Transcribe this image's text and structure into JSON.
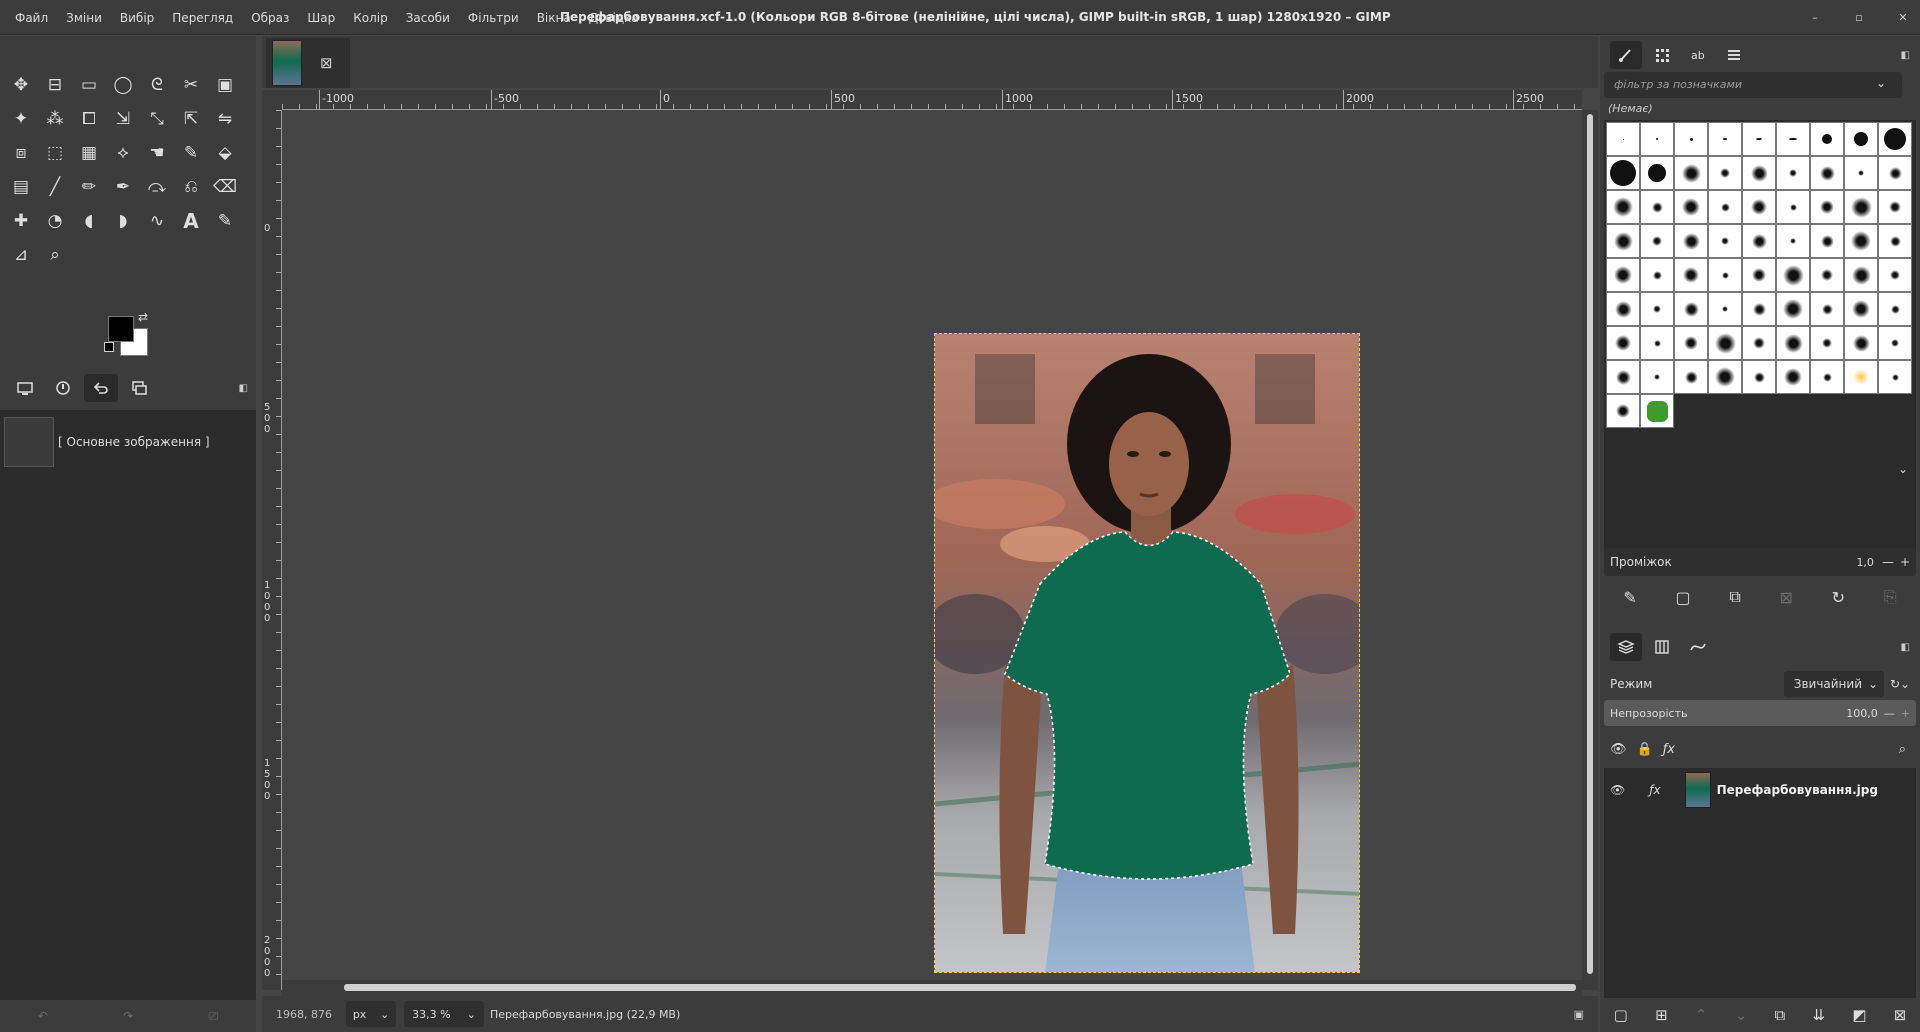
{
  "menu": [
    "Файл",
    "Зміни",
    "Вибір",
    "Перегляд",
    "Образ",
    "Шар",
    "Колір",
    "Засоби",
    "Фільтри",
    "Вікна",
    "Довідка"
  ],
  "window": {
    "title": "Перефарбовування.xcf-1.0 (Кольори RGB 8-бітове (нелінійне, цілі числа), GIMP built-in sRGB, 1 шар) 1280x1920 – GIMP",
    "min": "–",
    "max": "▫",
    "close": "✕"
  },
  "toolbox": {
    "tools": [
      "move-tool",
      "align-tool",
      "rect-select-tool",
      "ellipse-select-tool",
      "free-select-tool",
      "scissors-tool",
      "foreground-select-tool",
      "fuzzy-select-tool",
      "select-by-color-tool",
      "crop-tool",
      "unified-transform-tool",
      "warp-transform-tool",
      "handle-transform-tool",
      "flip-tool",
      "perspective-clone-tool",
      "3d-transform-tool",
      "cage-tool",
      "paths-tool",
      "smudge-tool",
      "mypaint-brush-tool",
      "bucket-fill-tool",
      "gradient-tool",
      "paintbrush-tool",
      "pencil-tool",
      "airbrush-tool",
      "ink-tool",
      "clone-tool",
      "eraser-tool",
      "heal-tool",
      "dodge-tool",
      "blur-tool",
      "dodge-burn-tool",
      "warp-tool",
      "text-tool",
      "color-picker-tool",
      "measure-tool",
      "zoom-tool"
    ],
    "fg_color": "#000000",
    "bg_color": "#ffffff"
  },
  "undo": {
    "item_label": "[ Основне зображення ]"
  },
  "canvas": {
    "tab_close": "⊠",
    "ruler_h": [
      "-1000",
      "-500",
      "0",
      "500",
      "1000",
      "1500",
      "2000",
      "2500"
    ],
    "ruler_v": [
      "0",
      "500",
      "1000",
      "1500",
      "2000"
    ],
    "coords": "1968, 876",
    "unit": "px",
    "zoom": "33,3 %",
    "info": "Перефарбовування.jpg (22,9 MB)"
  },
  "brushes": {
    "filter_placeholder": "фільтр за позначками",
    "current_name": "(Немає)",
    "spacing_label": "Проміжок",
    "spacing_value": "1,0"
  },
  "layers": {
    "mode_label": "Режим",
    "mode_value": "Звичайний",
    "opacity_label": "Непрозорість",
    "opacity_value": "100,0",
    "layer_name": "Перефарбовування.jpg"
  },
  "colors": {
    "accent": "#0e6b4f",
    "selection": "#e8d84a",
    "panel": "#3c3c3c",
    "canvas": "#454545"
  }
}
